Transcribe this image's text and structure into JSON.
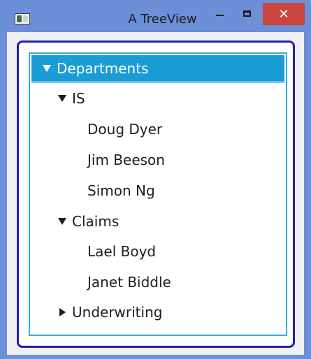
{
  "window": {
    "title": "A TreeView",
    "icon": "app-window-icon",
    "controls": {
      "minimize_icon": "minimize-icon",
      "maximize_icon": "maximize-icon",
      "close_glyph": "✕"
    },
    "colors": {
      "titlebar": "#6d8fd8",
      "close": "#c9453e",
      "outer_border": "#1f1fb8",
      "tree_border": "#2fb0d6",
      "selection": "#1a9cd6"
    }
  },
  "tree": {
    "root": {
      "label": "Departments",
      "expanded": true,
      "selected": true,
      "children": [
        {
          "label": "IS",
          "expanded": true,
          "children": [
            {
              "label": "Doug Dyer"
            },
            {
              "label": "Jim Beeson"
            },
            {
              "label": "Simon Ng"
            }
          ]
        },
        {
          "label": "Claims",
          "expanded": true,
          "children": [
            {
              "label": "Lael Boyd"
            },
            {
              "label": "Janet Biddle"
            }
          ]
        },
        {
          "label": "Underwriting",
          "expanded": false,
          "children": []
        }
      ]
    }
  }
}
